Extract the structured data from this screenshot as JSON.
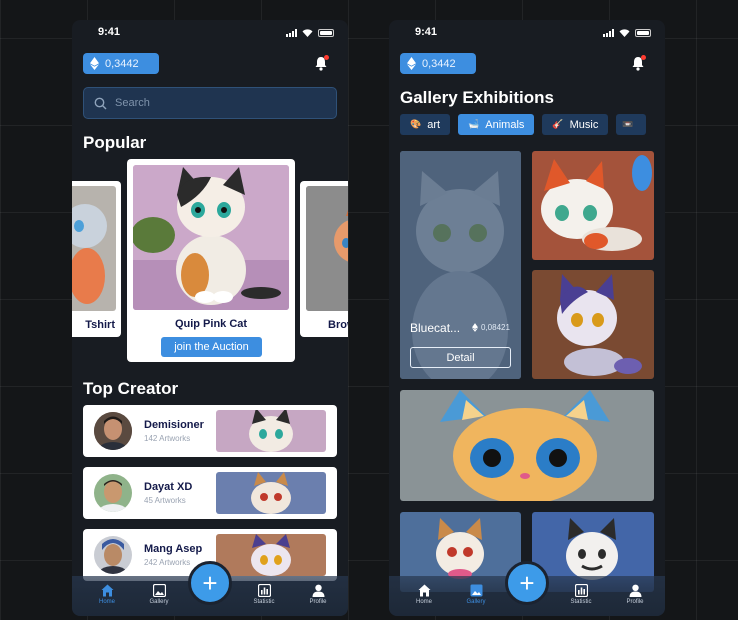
{
  "status": {
    "time": "9:41"
  },
  "wallet": {
    "balance": "0,3442"
  },
  "search": {
    "placeholder": "Search"
  },
  "home": {
    "popular_title": "Popular",
    "popular_cards": [
      {
        "label": "Tshirt"
      },
      {
        "label": "Quip Pink Cat",
        "button": "join the Auction"
      },
      {
        "label": "Brow"
      }
    ],
    "top_creator_title": "Top Creator",
    "creators": [
      {
        "name": "Demisioner",
        "artworks": "142 Artworks"
      },
      {
        "name": "Dayat XD",
        "artworks": "45 Artworks"
      },
      {
        "name": "Mang Asep",
        "artworks": "242 Artworks"
      }
    ]
  },
  "gallery": {
    "title": "Gallery Exhibitions",
    "chips": [
      {
        "label": "art",
        "icon": "palette-icon"
      },
      {
        "label": "Animals",
        "icon": "bathtub-icon"
      },
      {
        "label": "Music",
        "icon": "guitar-icon"
      }
    ],
    "feature": {
      "name": "Bluecat...",
      "price": "0,08421",
      "button": "Detail"
    }
  },
  "nav": {
    "items": [
      "Home",
      "Gallery",
      "Statistic",
      "Profile"
    ],
    "fab": "+"
  },
  "colors": {
    "accent": "#3d8ee0",
    "background": "#181c22",
    "card": "#ffffff",
    "dark_text": "#141a4a"
  }
}
